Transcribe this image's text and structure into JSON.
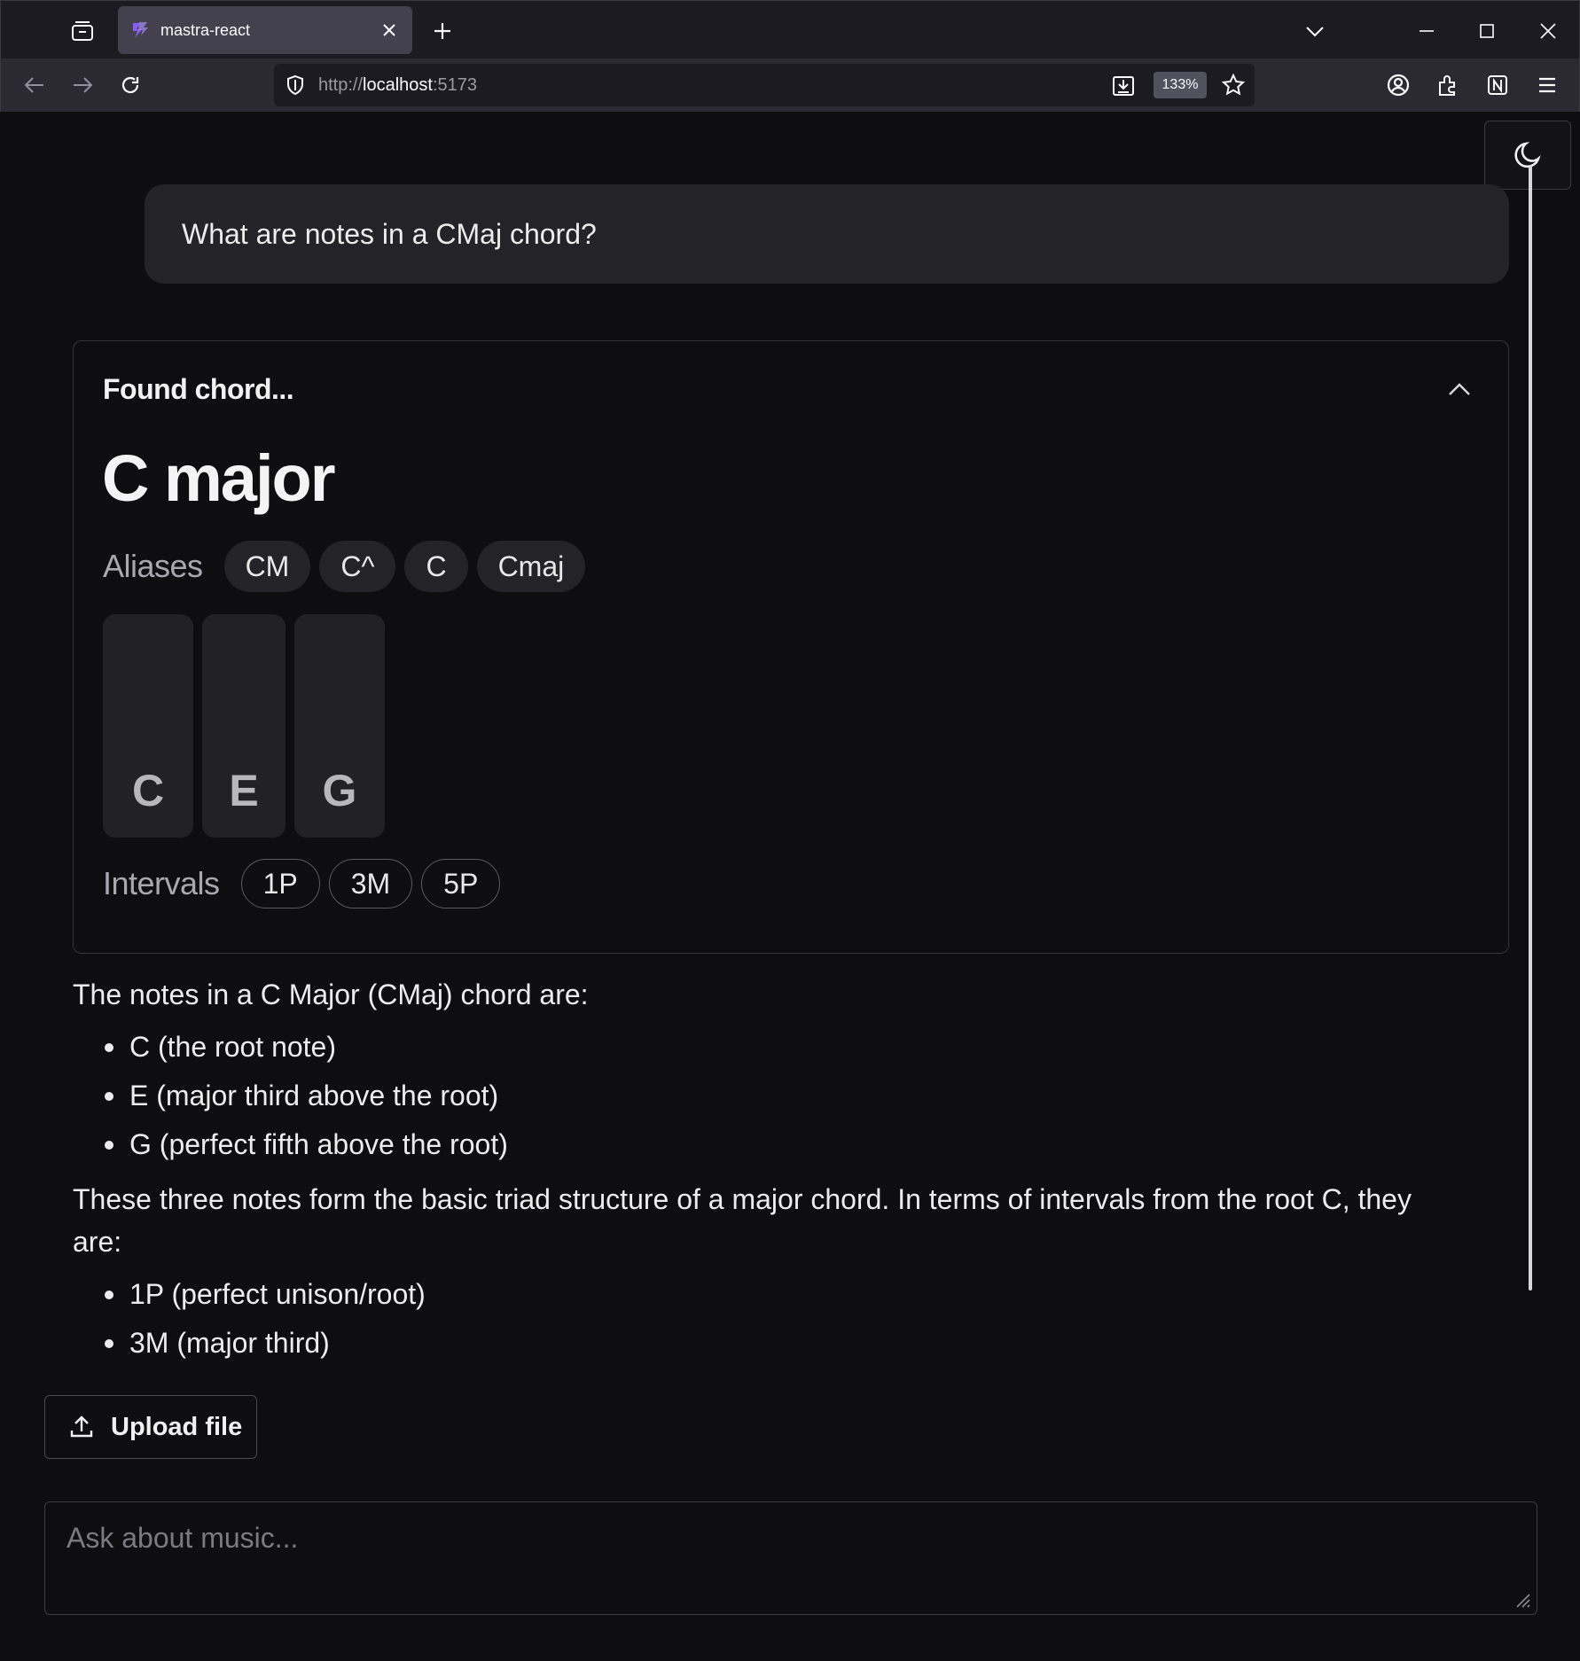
{
  "browser": {
    "tab_title": "mastra-react",
    "url_prefix": "http://",
    "url_host": "localhost",
    "url_suffix": ":5173",
    "zoom": "133%"
  },
  "colors": {
    "accent_favicon": "#8b5cf6",
    "page_bg": "#0e0e10",
    "bubble_bg": "#242428"
  },
  "user_message": "What are notes in a CMaj chord?",
  "chord_card": {
    "heading": "Found chord...",
    "chord_name": "C major",
    "aliases_label": "Aliases",
    "aliases": [
      "CM",
      "C^",
      "C",
      "Cmaj"
    ],
    "notes": [
      "C",
      "E",
      "G"
    ],
    "intervals_label": "Intervals",
    "intervals": [
      "1P",
      "3M",
      "5P"
    ]
  },
  "answer": {
    "intro": "The notes in a C Major (CMaj) chord are:",
    "notes_list": [
      "C (the root note)",
      "E (major third above the root)",
      "G (perfect fifth above the root)"
    ],
    "paragraph2": "These three notes form the basic triad structure of a major chord. In terms of intervals from the root C, they are:",
    "intervals_list": [
      "1P (perfect unison/root)",
      "3M (major third)"
    ]
  },
  "upload": {
    "label": "Upload file"
  },
  "input": {
    "placeholder": "Ask about music..."
  },
  "icons": [
    "tab-list-icon",
    "favicon-icon",
    "close-icon",
    "plus-icon",
    "chevron-down-icon",
    "minimize-icon",
    "maximize-icon",
    "back-icon",
    "forward-icon",
    "reload-icon",
    "shield-icon",
    "download-icon",
    "star-icon",
    "account-icon",
    "extensions-icon",
    "notion-icon",
    "menu-icon",
    "moon-icon",
    "chevron-up-icon",
    "upload-icon"
  ]
}
